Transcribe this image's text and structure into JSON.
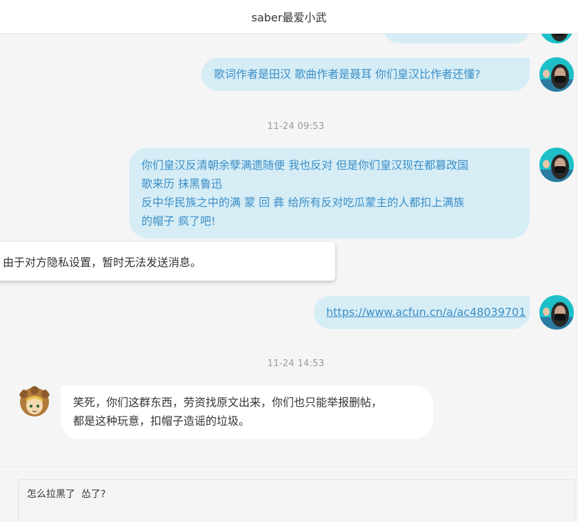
{
  "header": {
    "title": "saber最爱小武"
  },
  "messages": {
    "msg1": {
      "text": "歌词作者是田汉  歌曲作者是聂耳  你们皇汉比作者还懂?"
    },
    "time1": "11-24  09:53",
    "msg2": {
      "line1": "你们皇汉反清朝余孽满遗随便  我也反对  但是你们皇汉现在都篡改国",
      "line2": "歌来历  抹黑鲁迅",
      "line3": "反中华民族之中的满  蒙  回  彝  给所有反对吃瓜蒙主的人都扣上满族",
      "line4": "的帽子  疯了吧!"
    },
    "toast": "由于对方隐私设置，暂时无法发送消息。",
    "msg3": {
      "link": "https://www.acfun.cn/a/ac48039701"
    },
    "time2": "11-24  14:53",
    "msg4": {
      "line1": "笑死，你们这群东西，劳资找原文出来，你们也只能举报删帖，",
      "line2": "都是这种玩意，扣帽子造谣的垃圾。"
    }
  },
  "composer": {
    "value": "怎么拉黑了  怂了?"
  },
  "colors": {
    "sent_bubble": "#d6edf6",
    "sent_text": "#3b8ec7",
    "received_bubble": "#ffffff",
    "timestamp": "#999999"
  },
  "icons": {
    "self_avatar": "masked-person-avatar-icon",
    "other_avatar": "saber-lion-avatar-icon"
  }
}
